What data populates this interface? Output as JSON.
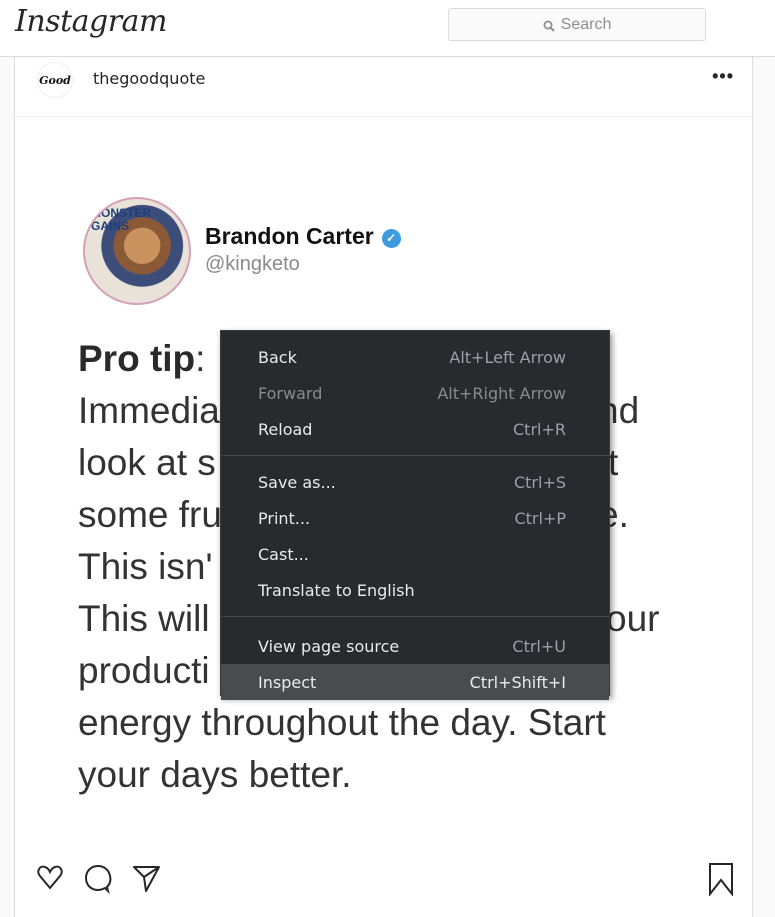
{
  "topbar": {
    "logo": "Instagram",
    "search_placeholder": "Search",
    "search_icon": "search-icon"
  },
  "post": {
    "author": "thegoodquote",
    "author_avatar_text": "Good",
    "more_icon": "more-options-icon",
    "tweet": {
      "name": "Brandon Carter",
      "verified": "✓",
      "handle": "@kingketo",
      "avatar_caption": "MONSTER GAINS",
      "text_bold": "Pro tip",
      "text_lines": [
        ": ",
        "Immedia",
        "look at s",
        "some fru",
        "This isn'",
        "This will",
        "producti",
        "energy throughout the day. Start",
        "your days better."
      ],
      "right_fragments": [
        "nd",
        "t",
        "e.",
        "our"
      ]
    },
    "actions": {
      "like": "heart-icon",
      "comment": "comment-icon",
      "share": "send-icon",
      "save": "bookmark-icon"
    }
  },
  "context_menu": {
    "groups": [
      [
        {
          "label": "Back",
          "shortcut": "Alt+Left Arrow",
          "disabled": false
        },
        {
          "label": "Forward",
          "shortcut": "Alt+Right Arrow",
          "disabled": true
        },
        {
          "label": "Reload",
          "shortcut": "Ctrl+R",
          "disabled": false
        }
      ],
      [
        {
          "label": "Save as...",
          "shortcut": "Ctrl+S",
          "disabled": false
        },
        {
          "label": "Print...",
          "shortcut": "Ctrl+P",
          "disabled": false
        },
        {
          "label": "Cast...",
          "shortcut": "",
          "disabled": false
        },
        {
          "label": "Translate to English",
          "shortcut": "",
          "disabled": false
        }
      ],
      [
        {
          "label": "View page source",
          "shortcut": "Ctrl+U",
          "disabled": false
        },
        {
          "label": "Inspect",
          "shortcut": "Ctrl+Shift+I",
          "disabled": false,
          "highlighted": true
        }
      ]
    ]
  }
}
